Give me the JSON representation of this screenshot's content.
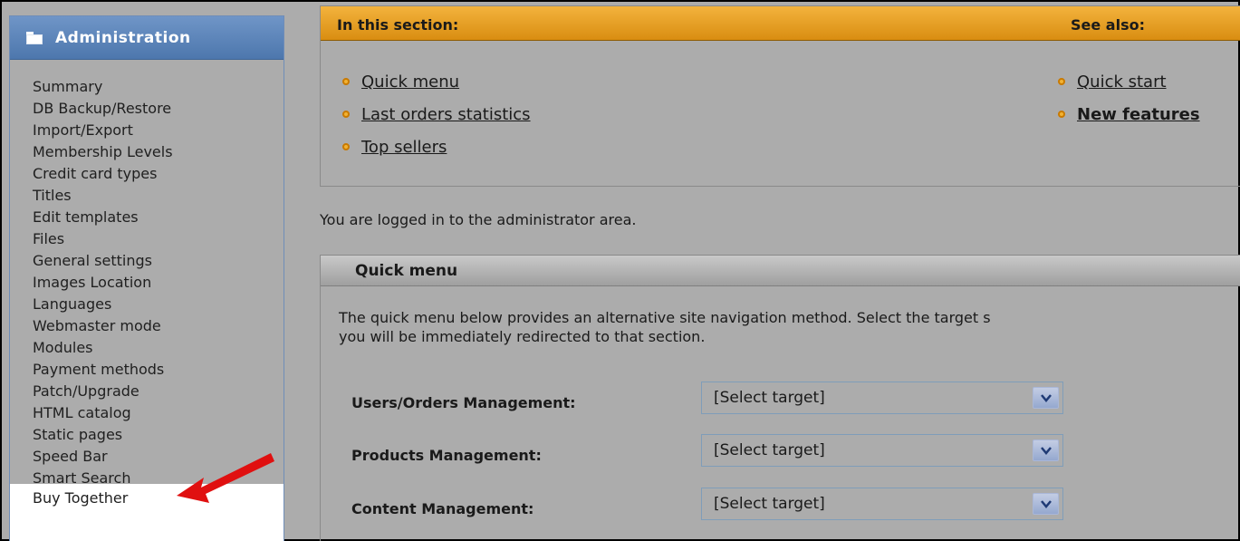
{
  "sidebar": {
    "title": "Administration",
    "items": [
      "Summary",
      "DB Backup/Restore",
      "Import/Export",
      "Membership Levels",
      "Credit card types",
      "Titles",
      "Edit templates",
      "Files",
      "General settings",
      "Images Location",
      "Languages",
      "Webmaster mode",
      "Modules",
      "Payment methods",
      "Patch/Upgrade",
      "HTML catalog",
      "Static pages",
      "Speed Bar",
      "Smart Search"
    ],
    "highlighted_item": "Buy Together"
  },
  "section": {
    "title": "In this section:",
    "see_also_title": "See also:",
    "links": [
      "Quick menu",
      "Last orders statistics",
      "Top sellers"
    ],
    "see_also_links": [
      "Quick start",
      "New features"
    ]
  },
  "status_text": "You are logged in to the administrator area.",
  "quick_menu": {
    "title": "Quick menu",
    "description_line1": "The quick menu below provides an alternative site navigation method. Select the target s",
    "description_line2": "you will be immediately redirected to that section.",
    "rows": [
      {
        "label": "Users/Orders Management:",
        "value": "[Select target]"
      },
      {
        "label": "Products Management:",
        "value": "[Select target]"
      },
      {
        "label": "Content Management:",
        "value": "[Select target]"
      }
    ]
  },
  "colors": {
    "section_bar": "#e9a22a",
    "sidebar_header": "#5b84b9",
    "arrow": "#e01010"
  }
}
